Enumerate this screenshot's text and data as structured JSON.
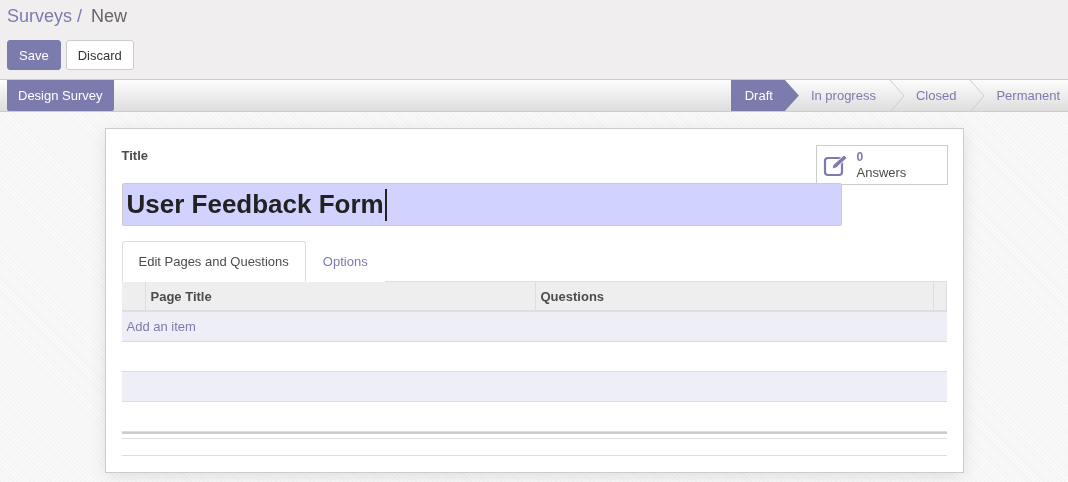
{
  "breadcrumb": {
    "parent": "Surveys /",
    "current": "New"
  },
  "buttons": [
    {
      "label": "Save",
      "kind": "primary"
    },
    {
      "label": "Discard",
      "kind": "secondary"
    }
  ],
  "header_button": "Design Survey",
  "stages": [
    {
      "label": "Draft",
      "selected": true
    },
    {
      "label": "In progress",
      "selected": false
    },
    {
      "label": "Closed",
      "selected": false
    },
    {
      "label": "Permanent",
      "selected": false
    }
  ],
  "stat_button": {
    "value": "0",
    "label": "Answers"
  },
  "title_field": {
    "label": "Title",
    "value": "User Feedback Form"
  },
  "tabs": [
    {
      "label": "Edit Pages and Questions",
      "selected": true
    },
    {
      "label": "Options",
      "selected": false
    }
  ],
  "table": {
    "columns": [
      "Page Title",
      "Questions"
    ],
    "add_item": "Add an item"
  }
}
